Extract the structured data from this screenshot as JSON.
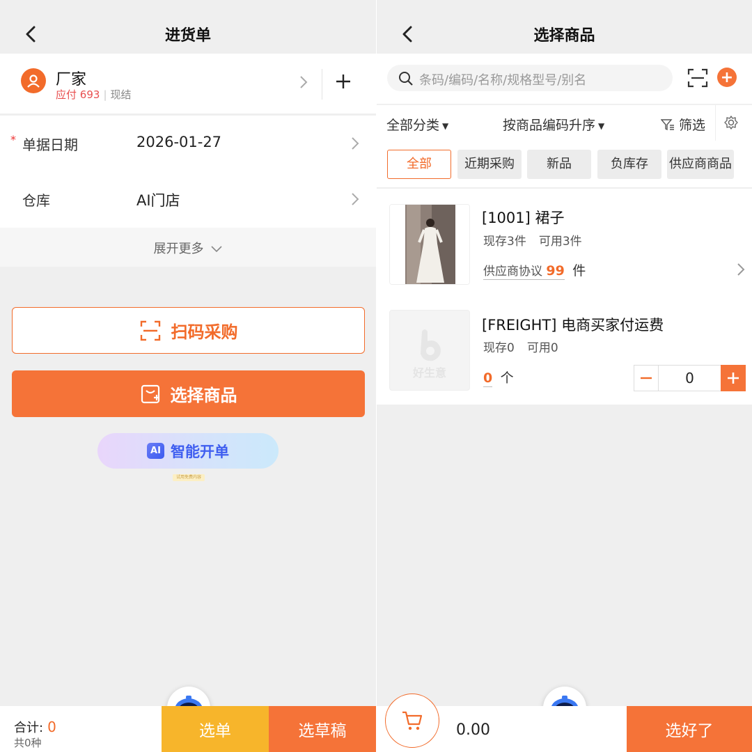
{
  "left": {
    "title": "进货单",
    "supplier": {
      "name": "厂家",
      "due_label": "应付",
      "due_amount": "693",
      "cash_label": "现结"
    },
    "date": {
      "label": "单据日期",
      "required_mark": "*",
      "value": "2026-01-27"
    },
    "warehouse": {
      "label": "仓库",
      "value": "AI门店"
    },
    "expand_label": "展开更多",
    "scan_button": "扫码采购",
    "select_button": "选择商品",
    "ai_badge": "AI",
    "ai_button": "智能开单",
    "ai_note": "试用免费内容",
    "bottom": {
      "total_label": "合计:",
      "total_value": "0",
      "kinds": "共0种",
      "pick_button": "选单",
      "draft_button": "选草稿"
    }
  },
  "right": {
    "title": "选择商品",
    "search_placeholder": "条码/编码/名称/规格型号/别名",
    "filters": {
      "category": "全部分类",
      "sort": "按商品编码升序",
      "screen": "筛选"
    },
    "tabs": [
      {
        "label": "全部",
        "active": true
      },
      {
        "label": "近期采购",
        "active": false
      },
      {
        "label": "新品",
        "active": false
      },
      {
        "label": "负库存",
        "active": false
      },
      {
        "label": "供应商商品",
        "active": false
      }
    ],
    "products": [
      {
        "name": "[1001] 裙子",
        "stock": "现存3件",
        "available": "可用3件",
        "price_label": "供应商协议",
        "price": "99",
        "unit": "件"
      },
      {
        "name": "[FREIGHT] 电商买家付运费",
        "stock": "现存0",
        "available": "可用0",
        "price": "0",
        "unit": "个",
        "qty": "0",
        "thumb_text": "好生意"
      }
    ],
    "bottom": {
      "amount": "0.00",
      "done_button": "选好了"
    }
  },
  "colors": {
    "accent": "#f57338",
    "accent_text": "#f26b2a",
    "yellow": "#f7b52b",
    "ai_blue": "#3f5ef0"
  },
  "icons": [
    "back-icon",
    "supplier-avatar-icon",
    "chevron-right-icon",
    "plus-icon",
    "scan-icon",
    "select-goods-icon",
    "robot-assistant-icon",
    "search-icon",
    "add-circle-icon",
    "filter-icon",
    "gear-icon",
    "cart-icon",
    "minus-icon"
  ]
}
